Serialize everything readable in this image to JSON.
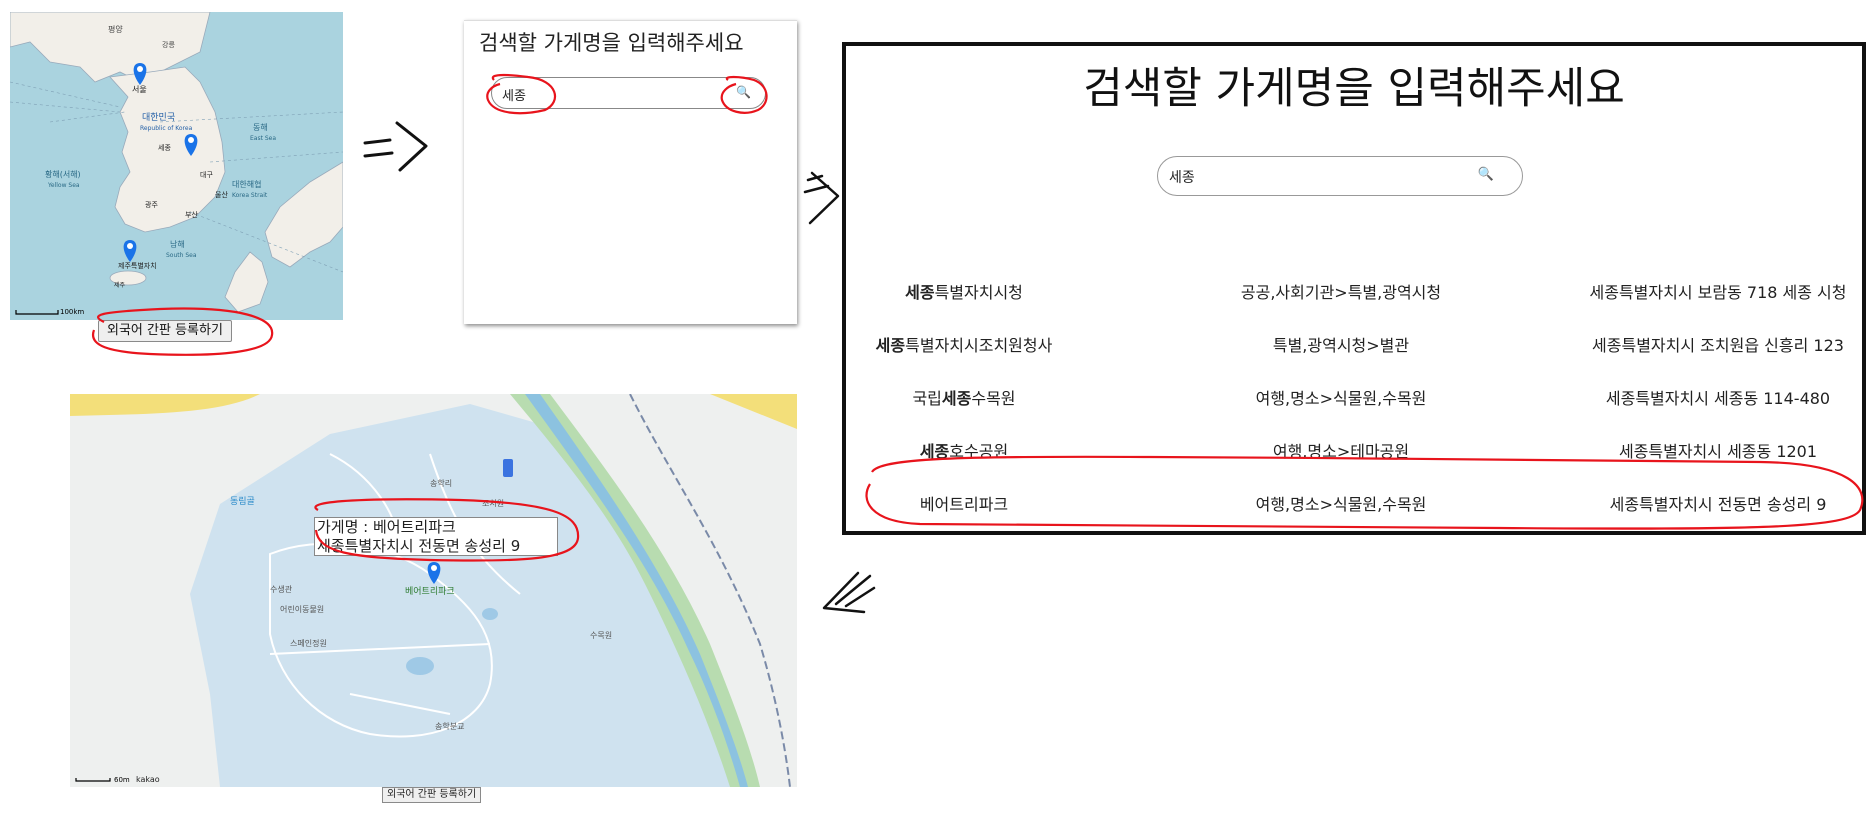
{
  "panel_map": {
    "labels": {
      "seoul": "서울",
      "korea": "대한민국",
      "korea_en": "Republic of Korea",
      "sejong": "세종",
      "daegu": "대구",
      "ulsan": "울산",
      "gwangju": "광주",
      "busan": "부산",
      "jeju": "제주",
      "jeju_sp": "제주특별자치",
      "yellow_sea": "황해(서해)",
      "yellow_sea_en": "Yellow Sea",
      "east_sea": "동해",
      "east_sea_en": "East Sea",
      "korea_strait": "대한해협",
      "korea_strait_en": "Korea Strait",
      "south_sea": "남해",
      "south_sea_en": "South Sea",
      "pyeongyang": "평양",
      "gangneung": "강릉",
      "scale": "100km"
    },
    "register_button": "외국어 간판 등록하기"
  },
  "panel_search_small": {
    "title": "검색할 가게명을 입력해주세요",
    "search_value": "세종",
    "search_icon": "search-icon"
  },
  "panel_results": {
    "title": "검색할 가게명을 입력해주세요",
    "search_value": "세종",
    "search_icon": "search-icon",
    "rows": [
      {
        "name_pre": "",
        "name_bold": "세종",
        "name_post": "특별자치시청",
        "category": "공공,사회기관>특별,광역시청",
        "address": "세종특별자치시 보람동 718 세종 시청"
      },
      {
        "name_pre": "",
        "name_bold": "세종",
        "name_post": "특별자치시조치원청사",
        "category": "특별,광역시청>별관",
        "address": "세종특별자치시 조치원읍 신흥리 123"
      },
      {
        "name_pre": "국립",
        "name_bold": "세종",
        "name_post": "수목원",
        "category": "여행,명소>식물원,수목원",
        "address": "세종특별자치시 세종동 114-480"
      },
      {
        "name_pre": "",
        "name_bold": "세종",
        "name_post": "호수공원",
        "category": "여행,명소>테마공원",
        "address": "세종특별자치시 세종동 1201"
      },
      {
        "name_pre": "베어트리파크",
        "name_bold": "",
        "name_post": "",
        "category": "여행,명소>식물원,수목원",
        "address": "세종특별자치시 전동면 송성리 9"
      }
    ]
  },
  "panel_detail_map": {
    "info_name_line": "가게명 : 베어트리파크",
    "info_address_line": "세종특별자치시 전동면 송성리 9",
    "place_label": "베어트리파크",
    "labels": [
      "동림골",
      "송학리",
      "조치원",
      "수생관",
      "어린이동물원",
      "스페인정원",
      "수목원",
      "송학분교"
    ],
    "scale": "60m",
    "brand": "kakao",
    "register_button": "외국어 간판 등록하기"
  },
  "colors": {
    "marker": "#1a73e8",
    "annotation": "#e8141c",
    "sea": "#aad3df",
    "land": "#f2efe9"
  }
}
